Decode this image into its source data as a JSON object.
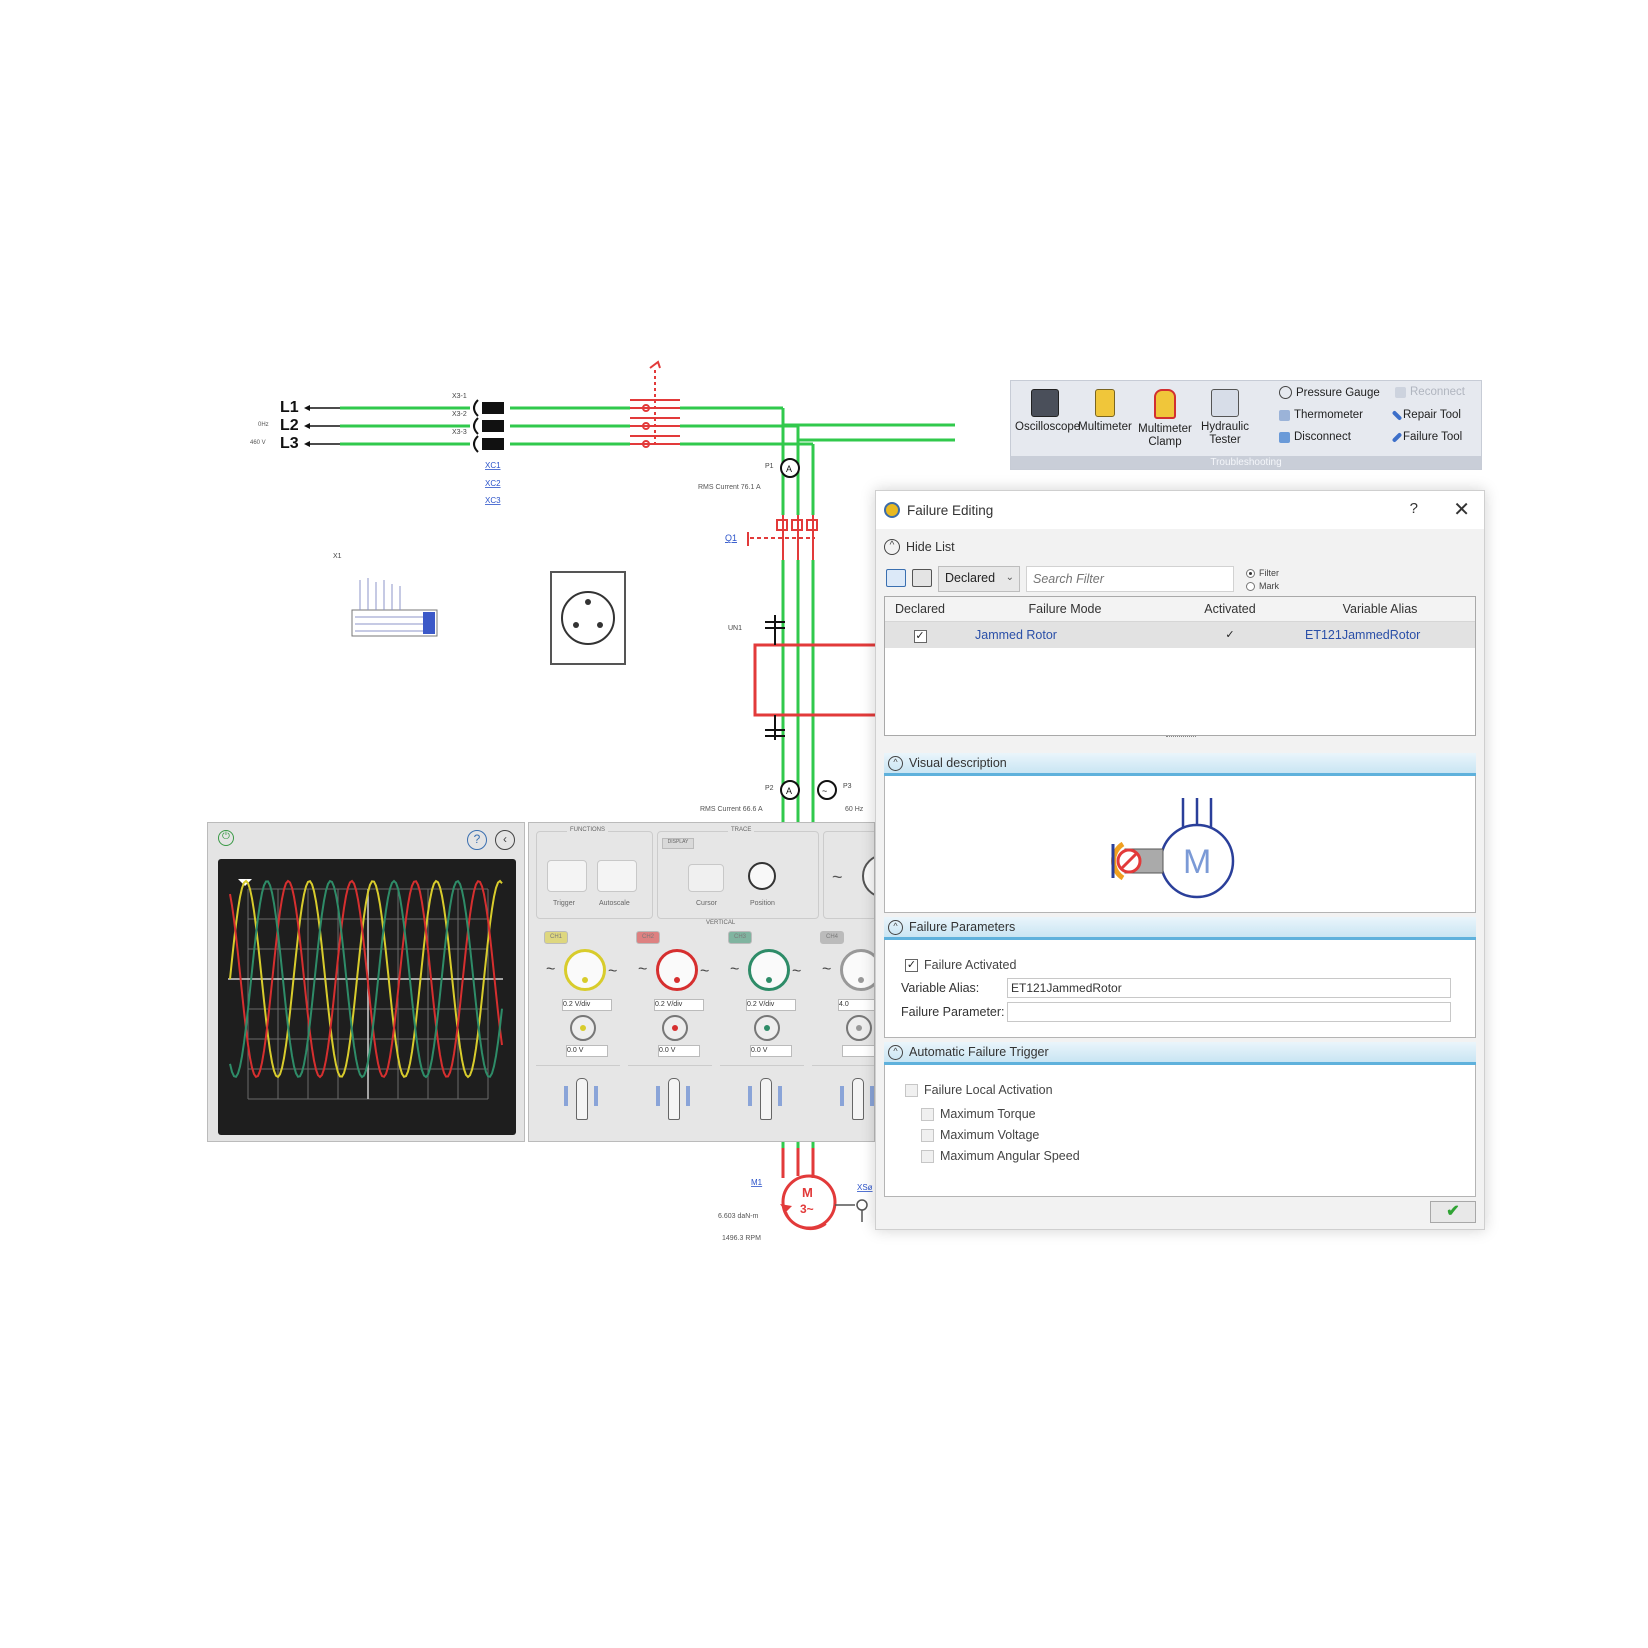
{
  "schematic": {
    "phases": [
      "L1",
      "L2",
      "L3"
    ],
    "supply_left_labels": [
      "0Hz",
      "460 V"
    ],
    "terminal_labels": [
      "X3-1",
      "X3-2",
      "X3-3"
    ],
    "terminal_links": [
      "XC1",
      "XC2",
      "XC3"
    ],
    "breaker_label": "Q1",
    "meter1": {
      "name": "P1",
      "reading": "RMS Current 76.1 A"
    },
    "meter2": {
      "name": "P2",
      "reading": "RMS Current 66.6 A"
    },
    "meter3": {
      "name": "P3",
      "reading": "60 Hz"
    },
    "drive_label": "UN1",
    "block_label": "X1",
    "motor": {
      "label": "M1",
      "symbol_top": "M",
      "symbol_bottom": "3~",
      "sensor_link": "XSø",
      "readings": [
        "6.603 daN-m",
        "1496.3 RPM"
      ]
    }
  },
  "ribbon": {
    "buttons": [
      {
        "label": "Oscilloscope",
        "icon": "oscilloscope-icon"
      },
      {
        "label": "Multimeter",
        "icon": "multimeter-icon"
      },
      {
        "label": "Multimeter Clamp",
        "icon": "clamp-meter-icon"
      },
      {
        "label": "Hydraulic Tester",
        "icon": "hydraulic-tester-icon"
      }
    ],
    "small_items": [
      "Pressure Gauge",
      "Thermometer",
      "Disconnect",
      "Reconnect",
      "Repair Tool",
      "Failure Tool"
    ],
    "group_label": "Troubleshooting"
  },
  "oscilloscope": {
    "functions_label": "FUNCTIONS",
    "trace_label": "TRACE",
    "vertical_label": "VERTICAL",
    "trigger_label": "Trigger",
    "autoscale_label": "Autoscale",
    "display_label": "DISPLAY",
    "cursor_label": "Cursor",
    "position_label": "Position",
    "channels": [
      {
        "name": "CH1",
        "color": "#d8cc2c",
        "volts_div": "0.2",
        "volts_unit": "V/div",
        "offset": "0.0",
        "offset_unit": "V"
      },
      {
        "name": "CH2",
        "color": "#d62f2f",
        "volts_div": "0.2",
        "volts_unit": "V/div",
        "offset": "0.0",
        "offset_unit": "V"
      },
      {
        "name": "CH3",
        "color": "#2e8c68",
        "volts_div": "0.2",
        "volts_unit": "V/div",
        "offset": "0.0",
        "offset_unit": "V"
      },
      {
        "name": "CH4",
        "color": "#999999",
        "volts_div": "4.0",
        "volts_unit": "",
        "offset": "",
        "offset_unit": ""
      }
    ]
  },
  "dialog": {
    "title": "Failure Editing",
    "help": "?",
    "close": "✕",
    "hide_list": "Hide List",
    "filter_select": "Declared",
    "search_placeholder": "Search Filter",
    "radio_filter": "Filter",
    "radio_mark": "Mark",
    "columns": [
      "Declared",
      "Failure Mode",
      "Activated",
      "Variable Alias"
    ],
    "rows": [
      {
        "declared": true,
        "failure_mode": "Jammed Rotor",
        "activated": true,
        "variable_alias": "ET121JammedRotor"
      }
    ],
    "visual_description": "Visual description",
    "visual_motor_letter": "M",
    "failure_parameters": "Failure Parameters",
    "failure_activated": "Failure Activated",
    "variable_alias_label": "Variable Alias:",
    "variable_alias_value": "ET121JammedRotor",
    "failure_parameter_label": "Failure Parameter:",
    "failure_parameter_value": "",
    "automatic_trigger": "Automatic Failure Trigger",
    "local_activation": "Failure Local Activation",
    "trigger_options": [
      "Maximum Torque",
      "Maximum Voltage",
      "Maximum Angular Speed"
    ],
    "ok_label": "✔"
  },
  "colors": {
    "wire_green": "#31c94c",
    "fault_red": "#e23a3a",
    "link_blue": "#2a52c9",
    "accent_blue": "#5fb1dc"
  }
}
